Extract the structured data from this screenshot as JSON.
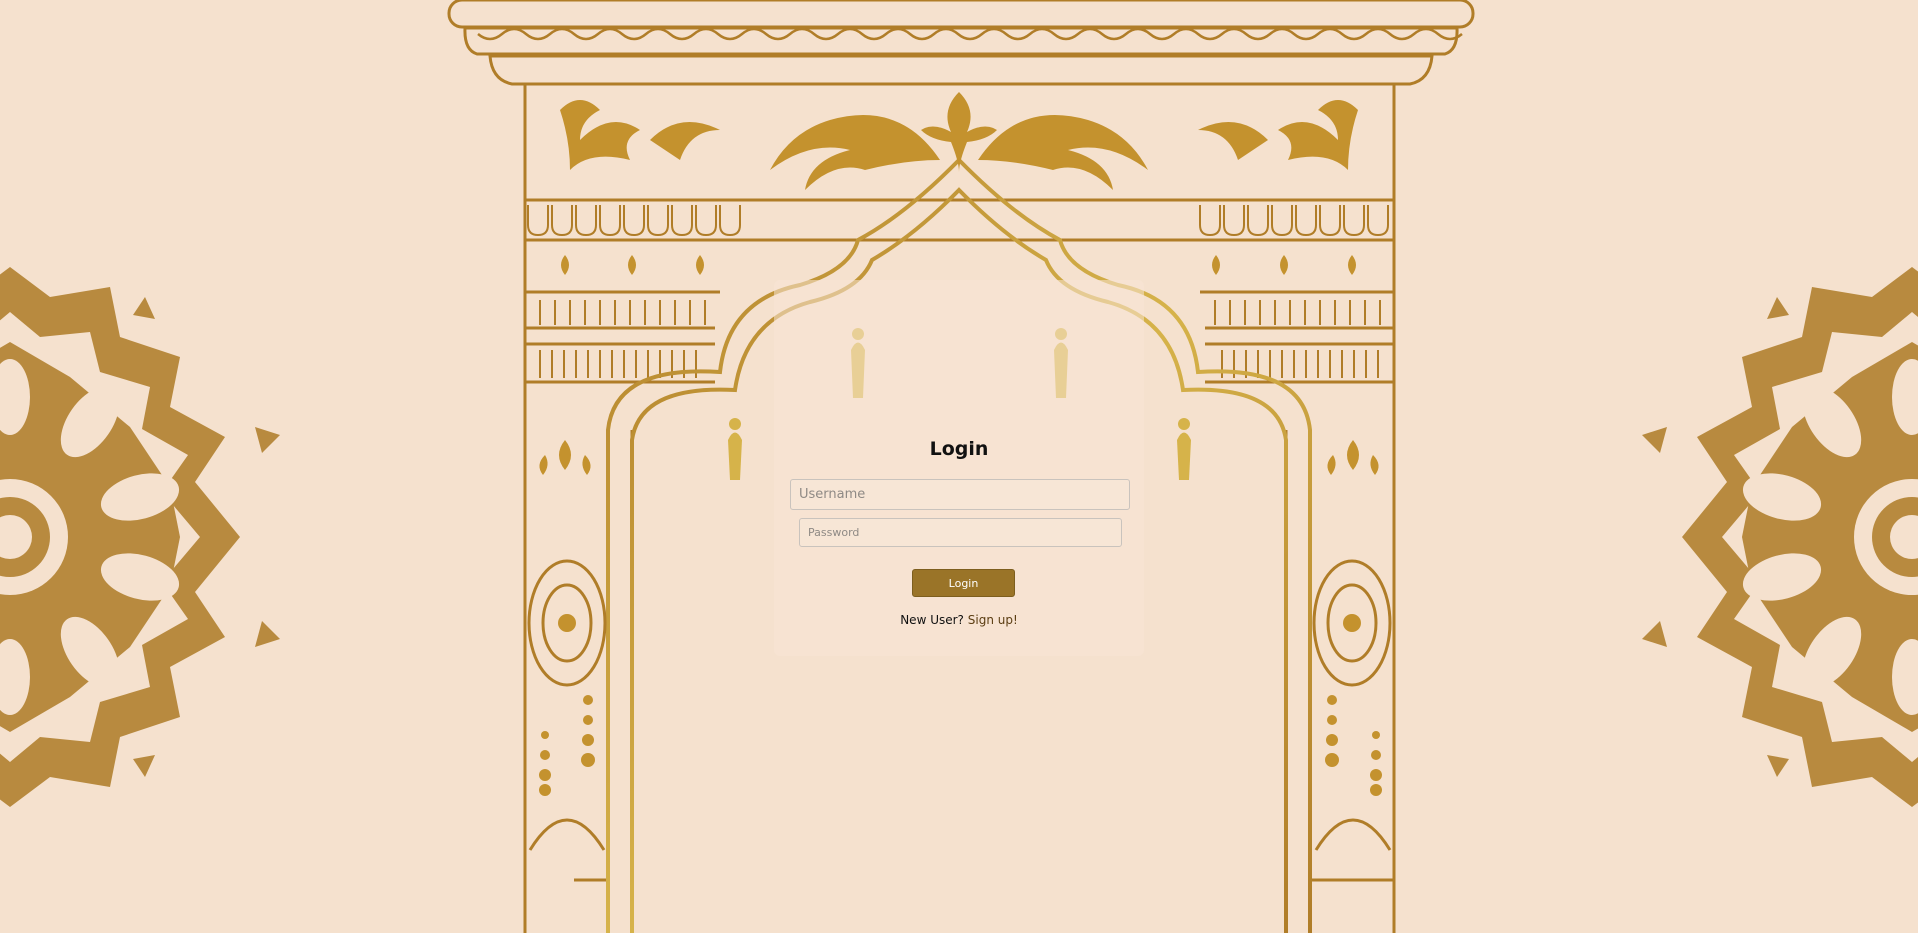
{
  "login": {
    "title": "Login",
    "username_placeholder": "Username",
    "password_placeholder": "Password",
    "button_label": "Login",
    "new_user_text": "New User?",
    "signup_link": "Sign up!"
  },
  "colors": {
    "background": "#f5e1ce",
    "ornament_gold": "#b58535",
    "arch_gold": "#c99f34",
    "button": "#9a7428"
  },
  "decorations": {
    "left": "mandala-ornament",
    "right": "mandala-ornament",
    "center": "indian-arch-gate-ornament"
  }
}
